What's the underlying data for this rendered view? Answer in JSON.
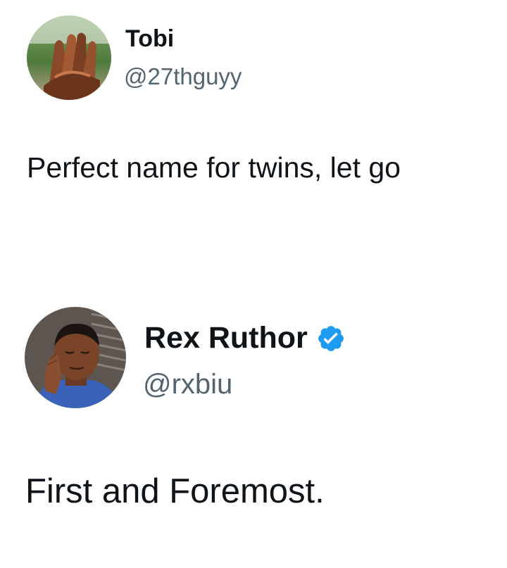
{
  "tweets": [
    {
      "author": {
        "display_name": "Tobi",
        "handle": "@27thguyy",
        "avatar_icon": "avatar-photo-hands",
        "verified": false
      },
      "text": "Perfect name for twins, let go"
    },
    {
      "author": {
        "display_name": "Rex Ruthor",
        "handle": "@rxbiu",
        "avatar_icon": "avatar-photo-man",
        "verified": true,
        "verified_icon": "verified-badge-icon",
        "verified_color": "#1d9bf0"
      },
      "text": "First and Foremost."
    }
  ],
  "colors": {
    "background": "#ffffff",
    "text_primary": "#0f1419",
    "text_secondary": "#536471",
    "verified_blue": "#1d9bf0"
  }
}
